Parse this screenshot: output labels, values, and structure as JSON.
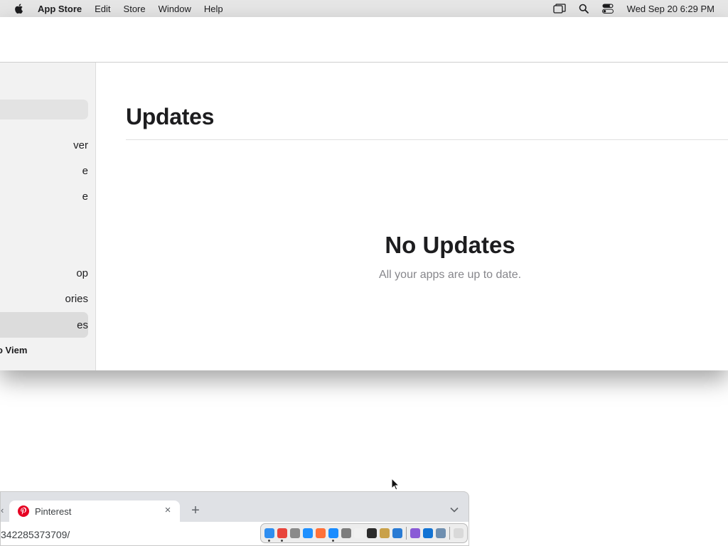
{
  "menubar": {
    "app_name": "App Store",
    "items": [
      "Edit",
      "Store",
      "Window",
      "Help"
    ],
    "clock": "Wed Sep 20  6:29 PM",
    "icons": [
      "apple-icon",
      "screen-mirroring-icon",
      "spotlight-search-icon",
      "control-center-icon"
    ]
  },
  "sidebar": {
    "items": [
      {
        "label": "ver",
        "selected": false
      },
      {
        "label": "e",
        "selected": false
      },
      {
        "label": "e",
        "selected": false
      },
      {
        "label": "op",
        "selected": false
      },
      {
        "label": "ories",
        "selected": false
      },
      {
        "label": "es",
        "selected": true
      }
    ],
    "account_label": "o Viem"
  },
  "main": {
    "title": "Updates",
    "empty_title": "No Updates",
    "empty_subtitle": "All your apps are up to date."
  },
  "browser": {
    "tab_title": "Pinterest",
    "url": "342285373709/",
    "close_glyph": "×",
    "new_tab_glyph": "+",
    "left_edge_glyph": "‹"
  },
  "dock": {
    "apps": [
      {
        "name": "finder-icon",
        "color": "#2f8ef0",
        "running": true
      },
      {
        "name": "chrome-icon",
        "color": "#e8453c",
        "running": true
      },
      {
        "name": "launchpad-icon",
        "color": "#8a8a8a",
        "running": false
      },
      {
        "name": "safari-icon",
        "color": "#1e90ff",
        "running": false
      },
      {
        "name": "firefox-icon",
        "color": "#ff7139",
        "running": false
      },
      {
        "name": "app-store-icon",
        "color": "#1a8cff",
        "running": true
      },
      {
        "name": "system-settings-icon",
        "color": "#7d7d7d",
        "running": false
      },
      {
        "name": "textedit-icon",
        "color": "#f0f0f0",
        "running": false
      },
      {
        "name": "terminal-icon",
        "color": "#2b2b2b",
        "running": false
      },
      {
        "name": "script-editor-icon",
        "color": "#c9a14a",
        "running": false
      },
      {
        "name": "vscode-icon",
        "color": "#2a7bd4",
        "running": false
      },
      {
        "name": "visual-studio-icon",
        "color": "#8a5bd6",
        "running": false
      },
      {
        "name": "outlook-icon",
        "color": "#1273d4",
        "running": false
      },
      {
        "name": "screenshot-icon",
        "color": "#6f8fb0",
        "running": false
      },
      {
        "name": "trash-icon",
        "color": "#d9d9d9",
        "running": false
      }
    ]
  }
}
